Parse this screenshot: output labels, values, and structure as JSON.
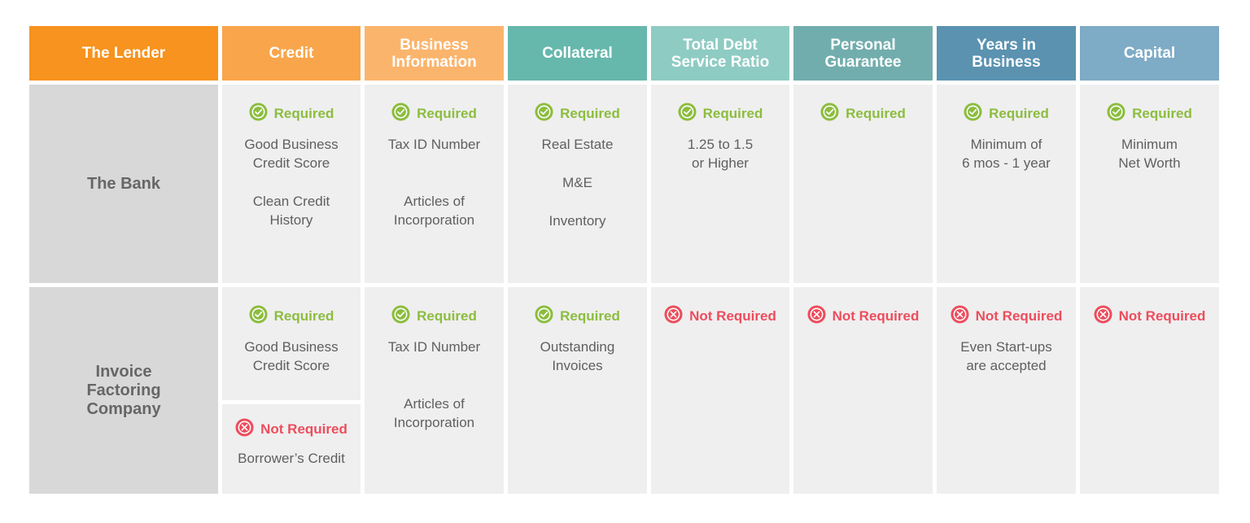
{
  "colors": {
    "required": "#8cbd3f",
    "not_required": "#ed4d5d",
    "row_label_bg": "#d8d8d8",
    "cell_bg": "#efefef",
    "header_colors": [
      "#f7931e",
      "#f9a54b",
      "#fbb46c",
      "#66b8ac",
      "#8ecbc3",
      "#72adad",
      "#5a92b0",
      "#7eabc6"
    ]
  },
  "headers": [
    "The Lender",
    "Credit",
    "Business\nInformation",
    "Collateral",
    "Total Debt\nService Ratio",
    "Personal\nGuarantee",
    "Years in\nBusiness",
    "Capital"
  ],
  "status_labels": {
    "required": "Required",
    "not_required": "Not Required"
  },
  "rows": [
    {
      "lender": "The Bank",
      "cells": [
        {
          "status": "Required",
          "lines": [
            "Good Business\nCredit Score",
            "Clean Credit\nHistory"
          ]
        },
        {
          "status": "Required",
          "lines": [
            "Tax ID Number",
            "\nArticles of\nIncorporation"
          ]
        },
        {
          "status": "Required",
          "lines": [
            "Real Estate",
            "M&E",
            "Inventory"
          ]
        },
        {
          "status": "Required",
          "lines": [
            "1.25 to 1.5\nor Higher"
          ]
        },
        {
          "status": "Required",
          "lines": []
        },
        {
          "status": "Required",
          "lines": [
            "Minimum of\n6 mos - 1 year"
          ]
        },
        {
          "status": "Required",
          "lines": [
            "Minimum\nNet Worth"
          ]
        }
      ]
    },
    {
      "lender": "Invoice\nFactoring\nCompany",
      "credit_split": [
        {
          "status": "Required",
          "lines": [
            "Good Business\nCredit Score"
          ]
        },
        {
          "status": "Not Required",
          "lines": [
            "Borrower’s Credit"
          ]
        }
      ],
      "cells": [
        {
          "status": "Required",
          "lines": [
            "Tax ID Number",
            "\nArticles of\nIncorporation"
          ]
        },
        {
          "status": "Required",
          "lines": [
            "Outstanding\nInvoices"
          ]
        },
        {
          "status": "Not Required",
          "lines": []
        },
        {
          "status": "Not Required",
          "lines": []
        },
        {
          "status": "Not Required",
          "lines": [
            "Even Start-ups\nare accepted"
          ]
        },
        {
          "status": "Not Required",
          "lines": []
        }
      ]
    }
  ]
}
